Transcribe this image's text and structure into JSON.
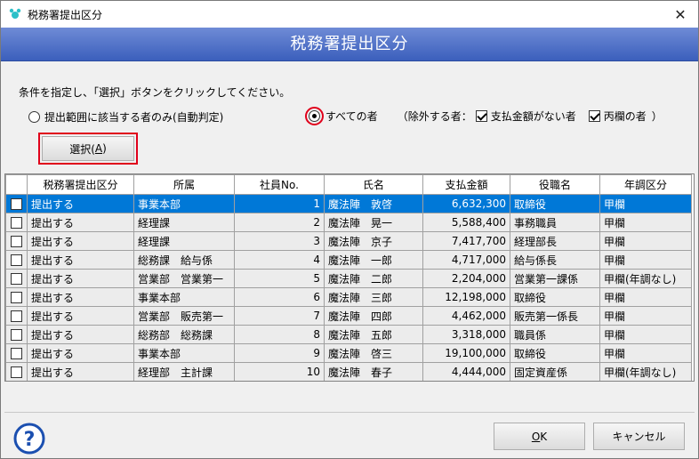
{
  "window": {
    "title": "税務署提出区分",
    "banner_title": "税務署提出区分"
  },
  "condition": {
    "instruction": "条件を指定し、「選択」ボタンをクリックしてください。",
    "option_auto": "提出範囲に該当する者のみ(自動判定)",
    "option_all": "すべての者",
    "exclude_prefix": "（除外する者：",
    "exclude_no_payment": "支払金額がない者",
    "exclude_hei": "丙欄の者",
    "exclude_suffix": "）",
    "selected_option": "all"
  },
  "select_button": {
    "label": "選択(",
    "key": "A",
    "label_end": ")"
  },
  "table": {
    "columns": [
      "",
      "税務署提出区分",
      "所属",
      "社員No.",
      "氏名",
      "支払金額",
      "役職名",
      "年調区分"
    ],
    "rows": [
      {
        "checked": false,
        "kubun": "提出する",
        "shozoku": "事業本部",
        "no": "1",
        "name": "魔法陣　敦啓",
        "amount": "6,632,300",
        "post": "取締役",
        "nencho": "甲欄",
        "selected": true
      },
      {
        "checked": false,
        "kubun": "提出する",
        "shozoku": "経理課",
        "no": "2",
        "name": "魔法陣　晃一",
        "amount": "5,588,400",
        "post": "事務職員",
        "nencho": "甲欄",
        "selected": false
      },
      {
        "checked": false,
        "kubun": "提出する",
        "shozoku": "経理課",
        "no": "3",
        "name": "魔法陣　京子",
        "amount": "7,417,700",
        "post": "経理部長",
        "nencho": "甲欄",
        "selected": false
      },
      {
        "checked": false,
        "kubun": "提出する",
        "shozoku": "総務課　給与係",
        "no": "4",
        "name": "魔法陣　一郎",
        "amount": "4,717,000",
        "post": "給与係長",
        "nencho": "甲欄",
        "selected": false
      },
      {
        "checked": false,
        "kubun": "提出する",
        "shozoku": "営業部　営業第一",
        "no": "5",
        "name": "魔法陣　二郎",
        "amount": "2,204,000",
        "post": "営業第一課係",
        "nencho": "甲欄(年調なし)",
        "selected": false
      },
      {
        "checked": false,
        "kubun": "提出する",
        "shozoku": "事業本部",
        "no": "6",
        "name": "魔法陣　三郎",
        "amount": "12,198,000",
        "post": "取締役",
        "nencho": "甲欄",
        "selected": false
      },
      {
        "checked": false,
        "kubun": "提出する",
        "shozoku": "営業部　販売第一",
        "no": "7",
        "name": "魔法陣　四郎",
        "amount": "4,462,000",
        "post": "販売第一係長",
        "nencho": "甲欄",
        "selected": false
      },
      {
        "checked": false,
        "kubun": "提出する",
        "shozoku": "総務部　総務課",
        "no": "8",
        "name": "魔法陣　五郎",
        "amount": "3,318,000",
        "post": "職員係",
        "nencho": "甲欄",
        "selected": false
      },
      {
        "checked": false,
        "kubun": "提出する",
        "shozoku": "事業本部",
        "no": "9",
        "name": "魔法陣　啓三",
        "amount": "19,100,000",
        "post": "取締役",
        "nencho": "甲欄",
        "selected": false
      },
      {
        "checked": false,
        "kubun": "提出する",
        "shozoku": "経理部　主計課",
        "no": "10",
        "name": "魔法陣　春子",
        "amount": "4,444,000",
        "post": "固定資産係",
        "nencho": "甲欄(年調なし)",
        "selected": false
      }
    ]
  },
  "footer": {
    "ok_key": "O",
    "ok_rest": "K",
    "cancel_label": "キャンセル"
  },
  "colors": {
    "banner": "#3b5fbc",
    "selection": "#0078d7",
    "highlight_ring": "#e0001b"
  }
}
